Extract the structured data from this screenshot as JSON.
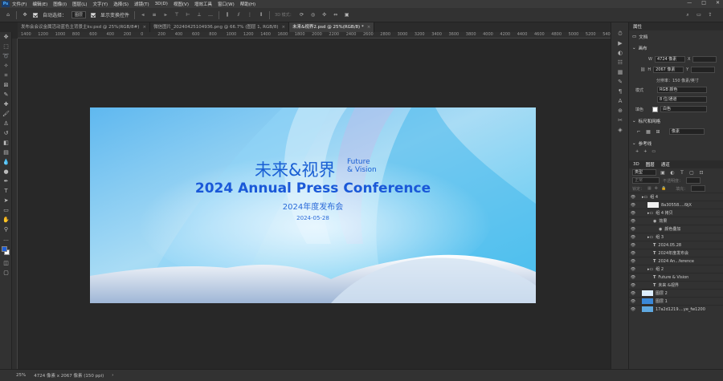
{
  "menu": {
    "logo": "Ps",
    "items": [
      "文件(F)",
      "编辑(E)",
      "图像(I)",
      "图层(L)",
      "文字(Y)",
      "选择(S)",
      "滤镜(T)",
      "3D(D)",
      "视图(V)",
      "增效工具",
      "窗口(W)",
      "帮助(H)"
    ]
  },
  "window_controls": [
    "—",
    "□",
    "✕"
  ],
  "options": {
    "auto_select_label": "自动选择：",
    "auto_select_value": "图层",
    "show_transform_label": "显示变换控件",
    "mode_label": "3D 模式："
  },
  "tabs": [
    {
      "label": "发布会会议金属活动蓝色主背景主kv.psd @ 25%(RGB/8#)",
      "close": "×"
    },
    {
      "label": "微信图片_20240425104936.png @ 66.7% (图层 1, RGB/8)",
      "close": "×"
    },
    {
      "label": "未来&视界2.psd @ 25%(RGB/8) *",
      "close": "×"
    }
  ],
  "ruler_ticks": [
    "1400",
    "1200",
    "1000",
    "800",
    "600",
    "400",
    "200",
    "0",
    "200",
    "400",
    "600",
    "800",
    "1000",
    "1200",
    "1400",
    "1600",
    "1800",
    "2000",
    "2200",
    "2400",
    "2600",
    "2800",
    "3000",
    "3200",
    "3400",
    "3600",
    "3800",
    "4000",
    "4200",
    "4400",
    "4600",
    "4800",
    "5000",
    "5200",
    "540"
  ],
  "document": {
    "title_cn": "未来&视界",
    "title_future": "Future",
    "title_vision": "& Vision",
    "title_en": "2024 Annual Press Conference",
    "subtitle_cn": "2024年度发布会",
    "date": "2024-05-28"
  },
  "status": {
    "zoom": "25%",
    "size": "4724 像素 x 2067 像素 (150 ppi)"
  },
  "properties": {
    "tab": "属性",
    "doc_label": "文档",
    "canvas_label": "画布",
    "w_label": "W",
    "w_value": "4724 像素",
    "x_label": "X",
    "h_label": "H",
    "h_value": "2067 像素",
    "y_label": "Y",
    "resolution": "分辨率：150 像素/英寸",
    "mode_label": "模式",
    "mode_value": "RGB 颜色",
    "depth_value": "8 位/通道",
    "fill_label": "填色",
    "fill_value": "白色",
    "rulers_label": "标尺和网格",
    "rulers_unit": "像素",
    "guides_label": "参考线"
  },
  "layers_panel": {
    "tabs": [
      "3D",
      "图层",
      "通道"
    ],
    "filter": "类型",
    "blend": "正常",
    "opacity": "不透明度：",
    "lock": "锁定：",
    "fill": "填充："
  },
  "layers": [
    {
      "name": "组 4",
      "indent": 0,
      "kind": "group"
    },
    {
      "name": "8a30558....i9jX",
      "indent": 1,
      "kind": "smart"
    },
    {
      "name": "组 4 拷贝",
      "indent": 1,
      "kind": "group"
    },
    {
      "name": "效果",
      "indent": 2,
      "kind": "fx"
    },
    {
      "name": "颜色叠加",
      "indent": 3,
      "kind": "fx"
    },
    {
      "name": "组 3",
      "indent": 1,
      "kind": "group"
    },
    {
      "name": "2024.05.28",
      "indent": 2,
      "kind": "text"
    },
    {
      "name": "2024年度发布会",
      "indent": 2,
      "kind": "text"
    },
    {
      "name": "2024 An...ference",
      "indent": 2,
      "kind": "text"
    },
    {
      "name": "组 2",
      "indent": 1,
      "kind": "group"
    },
    {
      "name": "Future & Vision",
      "indent": 2,
      "kind": "text"
    },
    {
      "name": "未来 &视界",
      "indent": 2,
      "kind": "text"
    },
    {
      "name": "图层 2",
      "indent": 0,
      "kind": "image"
    },
    {
      "name": "图层 1",
      "indent": 0,
      "kind": "image"
    },
    {
      "name": "17a2d1219....ye_fw1200",
      "indent": 0,
      "kind": "image"
    }
  ]
}
